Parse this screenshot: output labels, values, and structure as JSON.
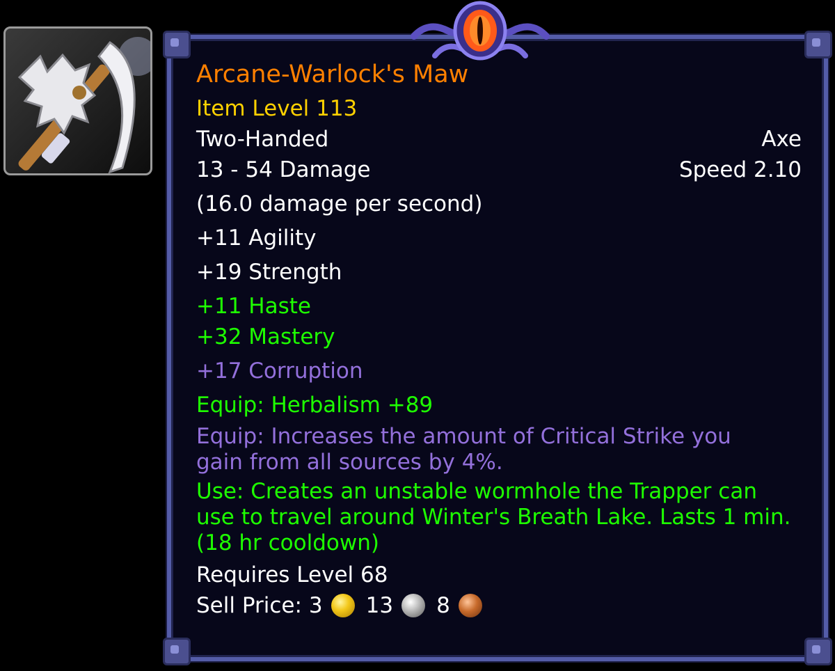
{
  "item": {
    "name": "Arcane-Warlock's Maw",
    "item_level": "Item Level 113",
    "slot": "Two-Handed",
    "type": "Axe",
    "damage": "13 - 54 Damage",
    "speed": "Speed 2.10",
    "dps": "(16.0 damage per second)",
    "stats": [
      "+11 Agility",
      "+19 Strength"
    ],
    "secondary_stats": [
      "+11 Haste",
      "+32 Mastery"
    ],
    "corruption": "+17 Corruption",
    "equip_profession": "Equip: Herbalism +89",
    "equip_corruption": "Equip: Increases the amount of Critical Strike you gain from all sources by 4%.",
    "use_effect": "Use: Creates an unstable wormhole the Trapper can use to travel around Winter's Breath Lake. Lasts 1 min. (18 hr cooldown)",
    "requires": "Requires Level 68",
    "sell_price": {
      "label": "Sell Price:",
      "gold": "3",
      "silver": "13",
      "copper": "8"
    }
  },
  "icon": {
    "name": "two-handed-axe-icon"
  },
  "colors": {
    "legendary_orange": "#ff8000",
    "item_level_yellow": "#ffd100",
    "bonus_green": "#1eff00",
    "corruption_purple": "#9370db",
    "background": "#07071a",
    "border": "#545ca8"
  }
}
